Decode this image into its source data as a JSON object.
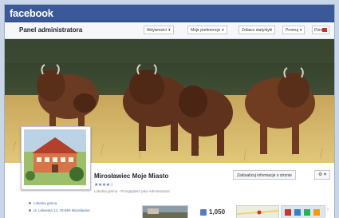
{
  "header": {
    "logo": "facebook"
  },
  "admin_panel": {
    "title": "Panel administratora",
    "buttons": [
      {
        "label": "Aktywności",
        "caret": "▾"
      },
      {
        "label": "Moje preferencje",
        "caret": "▾"
      },
      {
        "label": "Zobacz statystyki",
        "caret": ""
      },
      {
        "label": "Promuj",
        "caret": "▾"
      }
    ],
    "help": "Pomoc"
  },
  "page": {
    "name": "Mirosławiec Moje Miasto",
    "stars": "★★★★☆",
    "subline": "Lokalna gmina · Przeglądasz jako Administrator",
    "edit_button": "Zaktualizuj informacje o stronie",
    "gear_button": "⚙ ▾"
  },
  "info_items": [
    "Lokalna gmina",
    "ul. Lelewela 14, 78-650 Mirosławiec"
  ],
  "stats": {
    "likes": "1,050"
  },
  "icons": [
    "gear-icon",
    "like-icon",
    "chevron-right-icon"
  ],
  "colors": {
    "brand": "#3b5998",
    "bar": "#f6f7f9"
  }
}
